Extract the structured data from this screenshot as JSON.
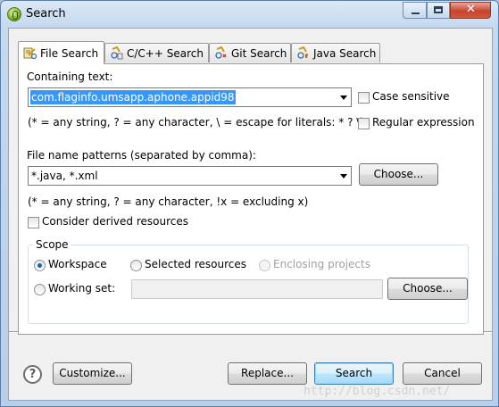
{
  "window": {
    "title": "Search",
    "title_icon": "eclipse-icon",
    "close_glyph": "✕"
  },
  "tabs": [
    {
      "label": "File Search",
      "icon": "file-search-icon"
    },
    {
      "label": "C/C++ Search",
      "icon": "cpp-search-icon"
    },
    {
      "label": "Git Search",
      "icon": "git-search-icon"
    },
    {
      "label": "Java Search",
      "icon": "java-search-icon"
    }
  ],
  "containing_text": {
    "label": "Containing text:",
    "value": "com.flaginfo.umsapp.aphone.appid98",
    "hint": "(* = any string, ? = any character, \\ = escape for literals: * ? \\)",
    "case_sensitive": {
      "label": "Case sensitive",
      "checked": false
    },
    "regular_expression": {
      "label": "Regular expression",
      "checked": false
    }
  },
  "file_name_patterns": {
    "label": "File name patterns (separated by comma):",
    "value": "*.java, *.xml",
    "hint": "(* = any string, ? = any character, !x = excluding x)",
    "choose_label": "Choose..."
  },
  "derived": {
    "label": "Consider derived resources",
    "checked": false
  },
  "scope": {
    "title": "Scope",
    "workspace": {
      "label": "Workspace",
      "selected": true
    },
    "selected_resources": {
      "label": "Selected resources",
      "selected": false
    },
    "enclosing_projects": {
      "label": "Enclosing projects",
      "enabled": false
    },
    "working_set": {
      "label": "Working set:",
      "selected": false,
      "value": ""
    },
    "choose_label": "Choose..."
  },
  "footer": {
    "help_glyph": "?",
    "customize_label": "Customize...",
    "replace_label": "Replace...",
    "search_label": "Search",
    "cancel_label": "Cancel"
  },
  "watermark": "http://blog.csdn.net/"
}
